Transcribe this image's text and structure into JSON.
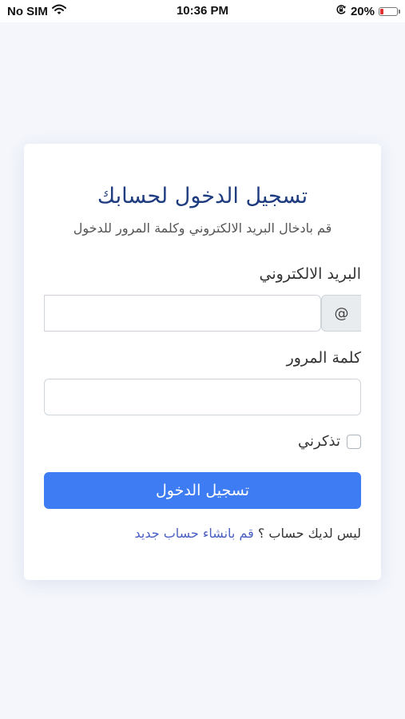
{
  "status_bar": {
    "carrier": "No SIM",
    "time": "10:36 PM",
    "battery_percent": "20%",
    "battery_level": 0.2,
    "battery_color": "#e0302f",
    "icons": [
      "wifi-icon",
      "orientation-lock-icon",
      "battery-icon"
    ]
  },
  "login": {
    "title": "تسجيل الدخول لحسابك",
    "subtitle": "قم بادخال البريد الالكتروني وكلمة المرور للدخول",
    "email_label": "البريد الالكتروني",
    "email_addon": "@",
    "email_value": "",
    "password_label": "كلمة المرور",
    "password_value": "",
    "remember_label": "تذكرني",
    "remember_checked": false,
    "submit_label": "تسجيل الدخول",
    "no_account_text": "ليس لديك حساب ؟",
    "signup_link": "قم بانشاء حساب جديد"
  },
  "colors": {
    "background": "#f4f6fc",
    "title": "#1f3c80",
    "primary_button": "#3d7cf2",
    "link": "#4a5fc1"
  }
}
